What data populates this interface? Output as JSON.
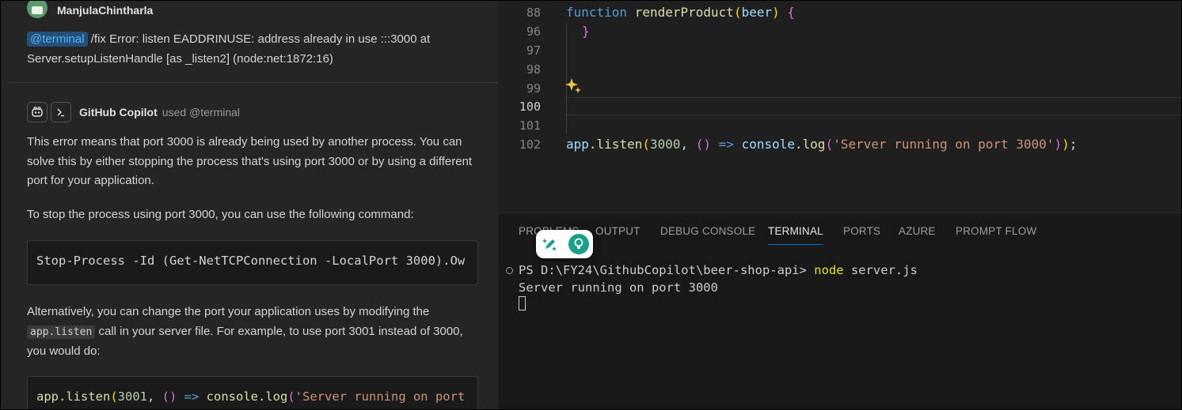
{
  "chat": {
    "user": {
      "name": "ManjulaChintharla",
      "mention": "@terminal",
      "message": " /fix Error: listen EADDRINUSE: address already in use :::3000 at Server.setupListenHandle [as _listen2] (node:net:1872:16)"
    },
    "copilot": {
      "name": "GitHub Copilot",
      "used": "used @terminal",
      "para1": "This error means that port 3000 is already being used by another process. You can solve this by either stopping the process that's using port 3000 or by using a different port for your application.",
      "para2": "To stop the process using port 3000, you can use the following command:",
      "code1": "Stop-Process -Id (Get-NetTCPConnection -LocalPort 3000).Ow",
      "para3_before": "Alternatively, you can change the port your application uses by modifying the ",
      "para3_code": "app.listen",
      "para3_after": " call in your server file. For example, to use port 3001 instead of 3000, you would do:",
      "code2": {
        "fn": "app.listen",
        "p1": "(",
        "num": "3001",
        "comma": ", ",
        "p2": "()",
        "arrow": " => ",
        "log": "console.log",
        "p3": "(",
        "str": "'Server running on port"
      }
    }
  },
  "editor": {
    "lines": [
      {
        "num": "88"
      },
      {
        "num": "96"
      },
      {
        "num": "97"
      },
      {
        "num": "98"
      },
      {
        "num": "99"
      },
      {
        "num": "100"
      },
      {
        "num": "101"
      },
      {
        "num": "102"
      }
    ],
    "line88": {
      "kw": "function",
      "fn": "renderProduct",
      "p1": "(",
      "param": "beer",
      "p2": ")",
      "brace": " {"
    },
    "line96": {
      "brace": "}"
    },
    "line102": {
      "obj": "app",
      "dot": ".",
      "fn": "listen",
      "p1": "(",
      "num": "3000",
      "comma": ", ",
      "p2": "()",
      "arrow": " => ",
      "log1": "console",
      "dot2": ".",
      "log2": "log",
      "p3": "(",
      "str": "'Server running on port 3000'",
      "p4": ")",
      "p5": ")",
      "semi": ";"
    }
  },
  "panel": {
    "tabs": [
      "PROBLEMS",
      "OUTPUT",
      "DEBUG CONSOLE",
      "TERMINAL",
      "PORTS",
      "AZURE",
      "PROMPT FLOW"
    ],
    "terminal": {
      "prompt": "PS D:\\FY24\\GithubCopilot\\beer-shop-api> ",
      "cmd": "node",
      "arg": " server.js",
      "output": "Server running on port 3000"
    }
  },
  "icons": {
    "avatar": "user-avatar",
    "copilot": "copilot-icon",
    "terminal": "terminal-icon",
    "sparkle": "sparkle-icon",
    "pen": "pen-sparkle-icon",
    "bulb": "lightbulb-icon"
  },
  "colors": {
    "accent": "#0078d4",
    "keyword": "#569cd6",
    "function": "#dcdcaa",
    "string": "#ce9178",
    "number": "#b5cea8"
  }
}
